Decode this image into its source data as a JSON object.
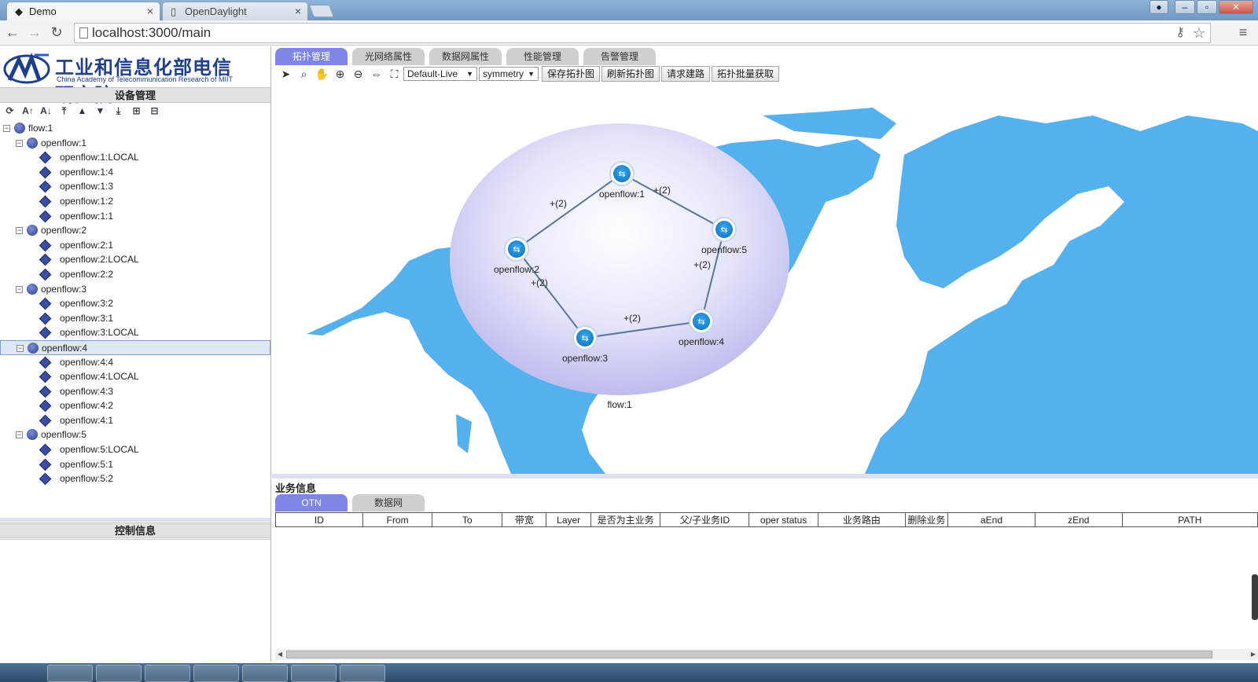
{
  "browser": {
    "tabs": [
      {
        "title": "Demo",
        "active": true
      },
      {
        "title": "OpenDaylight",
        "active": false
      }
    ],
    "url": "localhost:3000/main"
  },
  "logo": {
    "cn": "工业和信息化部电信研究院",
    "en": "China Academy of Telecommunication Research of MIIT"
  },
  "left": {
    "device_title": "设备管理",
    "control_title": "控制信息",
    "tree": [
      {
        "level": 0,
        "label": "flow:1",
        "type": "root",
        "expanded": true
      },
      {
        "level": 1,
        "label": "openflow:1",
        "type": "node",
        "expanded": true
      },
      {
        "level": 2,
        "label": "openflow:1:LOCAL",
        "type": "port"
      },
      {
        "level": 2,
        "label": "openflow:1:4",
        "type": "port"
      },
      {
        "level": 2,
        "label": "openflow:1:3",
        "type": "port"
      },
      {
        "level": 2,
        "label": "openflow:1:2",
        "type": "port"
      },
      {
        "level": 2,
        "label": "openflow:1:1",
        "type": "port"
      },
      {
        "level": 1,
        "label": "openflow:2",
        "type": "node",
        "expanded": true
      },
      {
        "level": 2,
        "label": "openflow:2:1",
        "type": "port"
      },
      {
        "level": 2,
        "label": "openflow:2:LOCAL",
        "type": "port"
      },
      {
        "level": 2,
        "label": "openflow:2:2",
        "type": "port"
      },
      {
        "level": 1,
        "label": "openflow:3",
        "type": "node",
        "expanded": true
      },
      {
        "level": 2,
        "label": "openflow:3:2",
        "type": "port"
      },
      {
        "level": 2,
        "label": "openflow:3:1",
        "type": "port"
      },
      {
        "level": 2,
        "label": "openflow:3:LOCAL",
        "type": "port"
      },
      {
        "level": 1,
        "label": "openflow:4",
        "type": "node",
        "expanded": true,
        "selected": true
      },
      {
        "level": 2,
        "label": "openflow:4:4",
        "type": "port"
      },
      {
        "level": 2,
        "label": "openflow:4:LOCAL",
        "type": "port"
      },
      {
        "level": 2,
        "label": "openflow:4:3",
        "type": "port"
      },
      {
        "level": 2,
        "label": "openflow:4:2",
        "type": "port"
      },
      {
        "level": 2,
        "label": "openflow:4:1",
        "type": "port"
      },
      {
        "level": 1,
        "label": "openflow:5",
        "type": "node",
        "expanded": true
      },
      {
        "level": 2,
        "label": "openflow:5:LOCAL",
        "type": "port"
      },
      {
        "level": 2,
        "label": "openflow:5:1",
        "type": "port"
      },
      {
        "level": 2,
        "label": "openflow:5:2",
        "type": "port"
      }
    ],
    "tree_tools": [
      "refresh-icon",
      "sort-asc-icon",
      "sort-desc-icon",
      "move-top-icon",
      "move-up-icon",
      "move-down-icon",
      "move-bottom-icon",
      "expand-all-icon",
      "collapse-all-icon"
    ]
  },
  "main_tabs": [
    {
      "label": "拓扑管理",
      "active": true
    },
    {
      "label": "光网络属性",
      "active": false
    },
    {
      "label": "数据网属性",
      "active": false
    },
    {
      "label": "性能管理",
      "active": false
    },
    {
      "label": "告警管理",
      "active": false
    }
  ],
  "topo_toolbar": {
    "icons": [
      "pointer-icon",
      "search-icon",
      "pan-hand-icon",
      "zoom-in-icon",
      "zoom-out-icon",
      "fit-view-icon",
      "overview-icon"
    ],
    "mode_select": "Default-Live",
    "layout_select": "symmetry",
    "buttons": [
      "保存拓扑图",
      "刷新拓扑图",
      "请求建路",
      "拓扑批量获取"
    ]
  },
  "topology": {
    "group_label": "flow:1",
    "nodes": [
      {
        "id": "openflow:1",
        "label": "openflow:1"
      },
      {
        "id": "openflow:2",
        "label": "openflow:2"
      },
      {
        "id": "openflow:3",
        "label": "openflow:3"
      },
      {
        "id": "openflow:4",
        "label": "openflow:4"
      },
      {
        "id": "openflow:5",
        "label": "openflow:5"
      }
    ],
    "links": [
      {
        "from": "openflow:1",
        "to": "openflow:2",
        "label": "+(2)"
      },
      {
        "from": "openflow:1",
        "to": "openflow:5",
        "label": "+(2)"
      },
      {
        "from": "openflow:2",
        "to": "openflow:3",
        "label": "+(2)"
      },
      {
        "from": "openflow:3",
        "to": "openflow:4",
        "label": "+(2)"
      },
      {
        "from": "openflow:5",
        "to": "openflow:4",
        "label": "+(2)"
      }
    ],
    "map_color": "#55b0ee",
    "group_color": "#c9c8f2"
  },
  "business": {
    "title": "业务信息",
    "tabs": [
      {
        "label": "OTN",
        "active": true
      },
      {
        "label": "数据网",
        "active": false
      }
    ],
    "columns": [
      "ID",
      "From",
      "To",
      "带宽",
      "Layer",
      "是否为主业务",
      "父/子业务ID",
      "oper status",
      "业务路由",
      "删除业务",
      "aEnd",
      "zEnd",
      "PATH"
    ]
  },
  "colors": {
    "accent": "#7d86e6",
    "panel_header": "#e2e2e2"
  }
}
